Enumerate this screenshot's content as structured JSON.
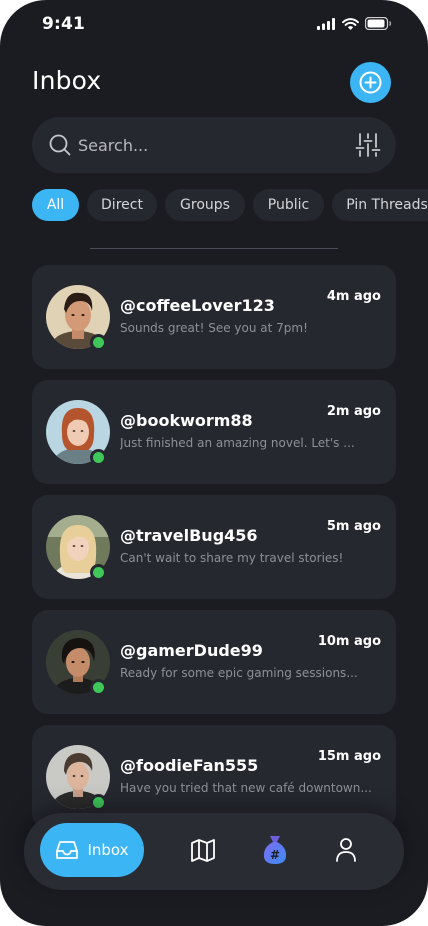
{
  "status_bar": {
    "time": "9:41"
  },
  "header": {
    "title": "Inbox"
  },
  "search": {
    "placeholder": "Search..."
  },
  "filters": [
    {
      "label": "All",
      "active": true
    },
    {
      "label": "Direct",
      "active": false
    },
    {
      "label": "Groups",
      "active": false
    },
    {
      "label": "Public",
      "active": false
    },
    {
      "label": "Pin Threads",
      "active": false
    }
  ],
  "conversations": [
    {
      "handle": "@coffeeLover123",
      "preview": "Sounds great! See you at 7pm!",
      "time": "4m ago",
      "online": true
    },
    {
      "handle": "@bookworm88",
      "preview": "Just finished an amazing novel. Let's ...",
      "time": "2m ago",
      "online": true
    },
    {
      "handle": "@travelBug456",
      "preview": "Can't wait to share my travel stories!",
      "time": "5m ago",
      "online": true
    },
    {
      "handle": "@gamerDude99",
      "preview": "Ready for some epic gaming sessions...",
      "time": "10m ago",
      "online": true
    },
    {
      "handle": "@foodieFan555",
      "preview": "Have you tried that new café downtown...",
      "time": "15m ago",
      "online": true
    }
  ],
  "tab_bar": {
    "items": [
      {
        "label": "Inbox",
        "icon": "inbox-icon",
        "active": true
      },
      {
        "label": "",
        "icon": "map-icon",
        "active": false
      },
      {
        "label": "",
        "icon": "hashtag-bag-icon",
        "active": false
      },
      {
        "label": "",
        "icon": "profile-icon",
        "active": false
      }
    ]
  },
  "colors": {
    "background": "#1b1c22",
    "surface": "#262830",
    "accent": "#3cb5f4",
    "online": "#3ec85a",
    "muted_text": "#8e9098"
  }
}
